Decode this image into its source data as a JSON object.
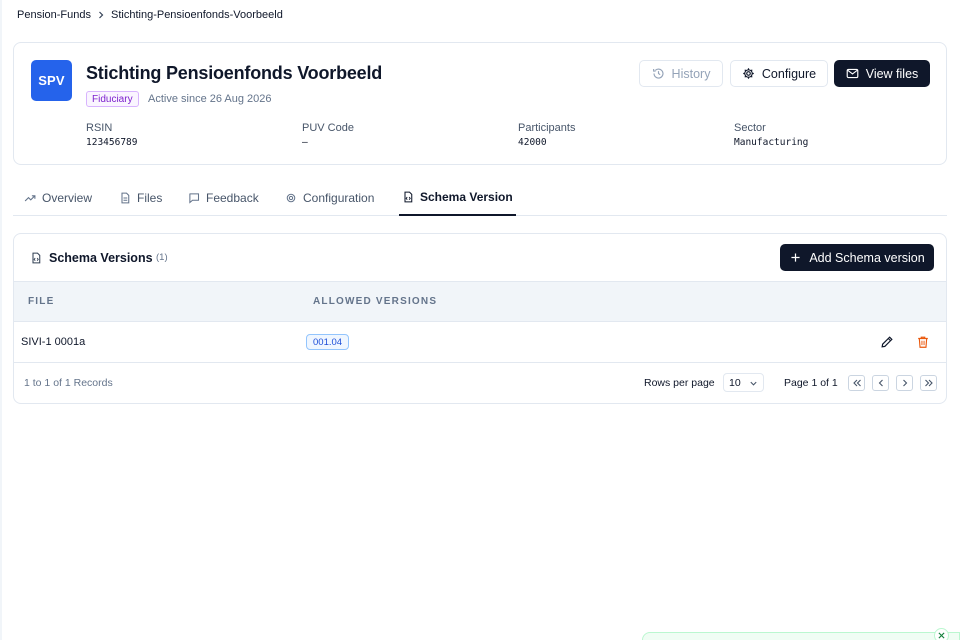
{
  "breadcrumb": {
    "items": [
      "Pension-Funds",
      "Stichting-Pensioenfonds-Voorbeeld"
    ]
  },
  "fund": {
    "avatar": "SPV",
    "name": "Stichting Pensioenfonds Voorbeeld",
    "badge": "Fiduciary",
    "active_since": "Active since 26 Aug 2026",
    "avatar_color": "#2563eb"
  },
  "actions": {
    "history": "History",
    "configure": "Configure",
    "view_files": "View files"
  },
  "meta": [
    {
      "label": "RSIN",
      "value": "123456789"
    },
    {
      "label": "PUV Code",
      "value": "–"
    },
    {
      "label": "Participants",
      "value": "42000"
    },
    {
      "label": "Sector",
      "value": "Manufacturing"
    }
  ],
  "tabs": [
    {
      "label": "Overview",
      "icon": "trend-up-icon"
    },
    {
      "label": "Files",
      "icon": "file-icon"
    },
    {
      "label": "Feedback",
      "icon": "message-icon"
    },
    {
      "label": "Configuration",
      "icon": "gear-icon"
    },
    {
      "label": "Schema Version",
      "icon": "file-code-icon",
      "active": true
    }
  ],
  "schema": {
    "title": "Schema Versions",
    "count": "(1)",
    "add_button": "Add Schema version",
    "columns": [
      "File",
      "Allowed versions"
    ],
    "rows": [
      {
        "file": "SIVI-1 0001a",
        "versions": [
          "001.04"
        ]
      }
    ],
    "records": "1 to 1 of 1 Records",
    "rows_per_page_label": "Rows per page",
    "rows_per_page": "10",
    "page": "Page 1 of 1"
  },
  "colors": {
    "primary_dark": "#0f172a",
    "delete": "#ea580c",
    "version_badge": "#1d4ed8"
  }
}
